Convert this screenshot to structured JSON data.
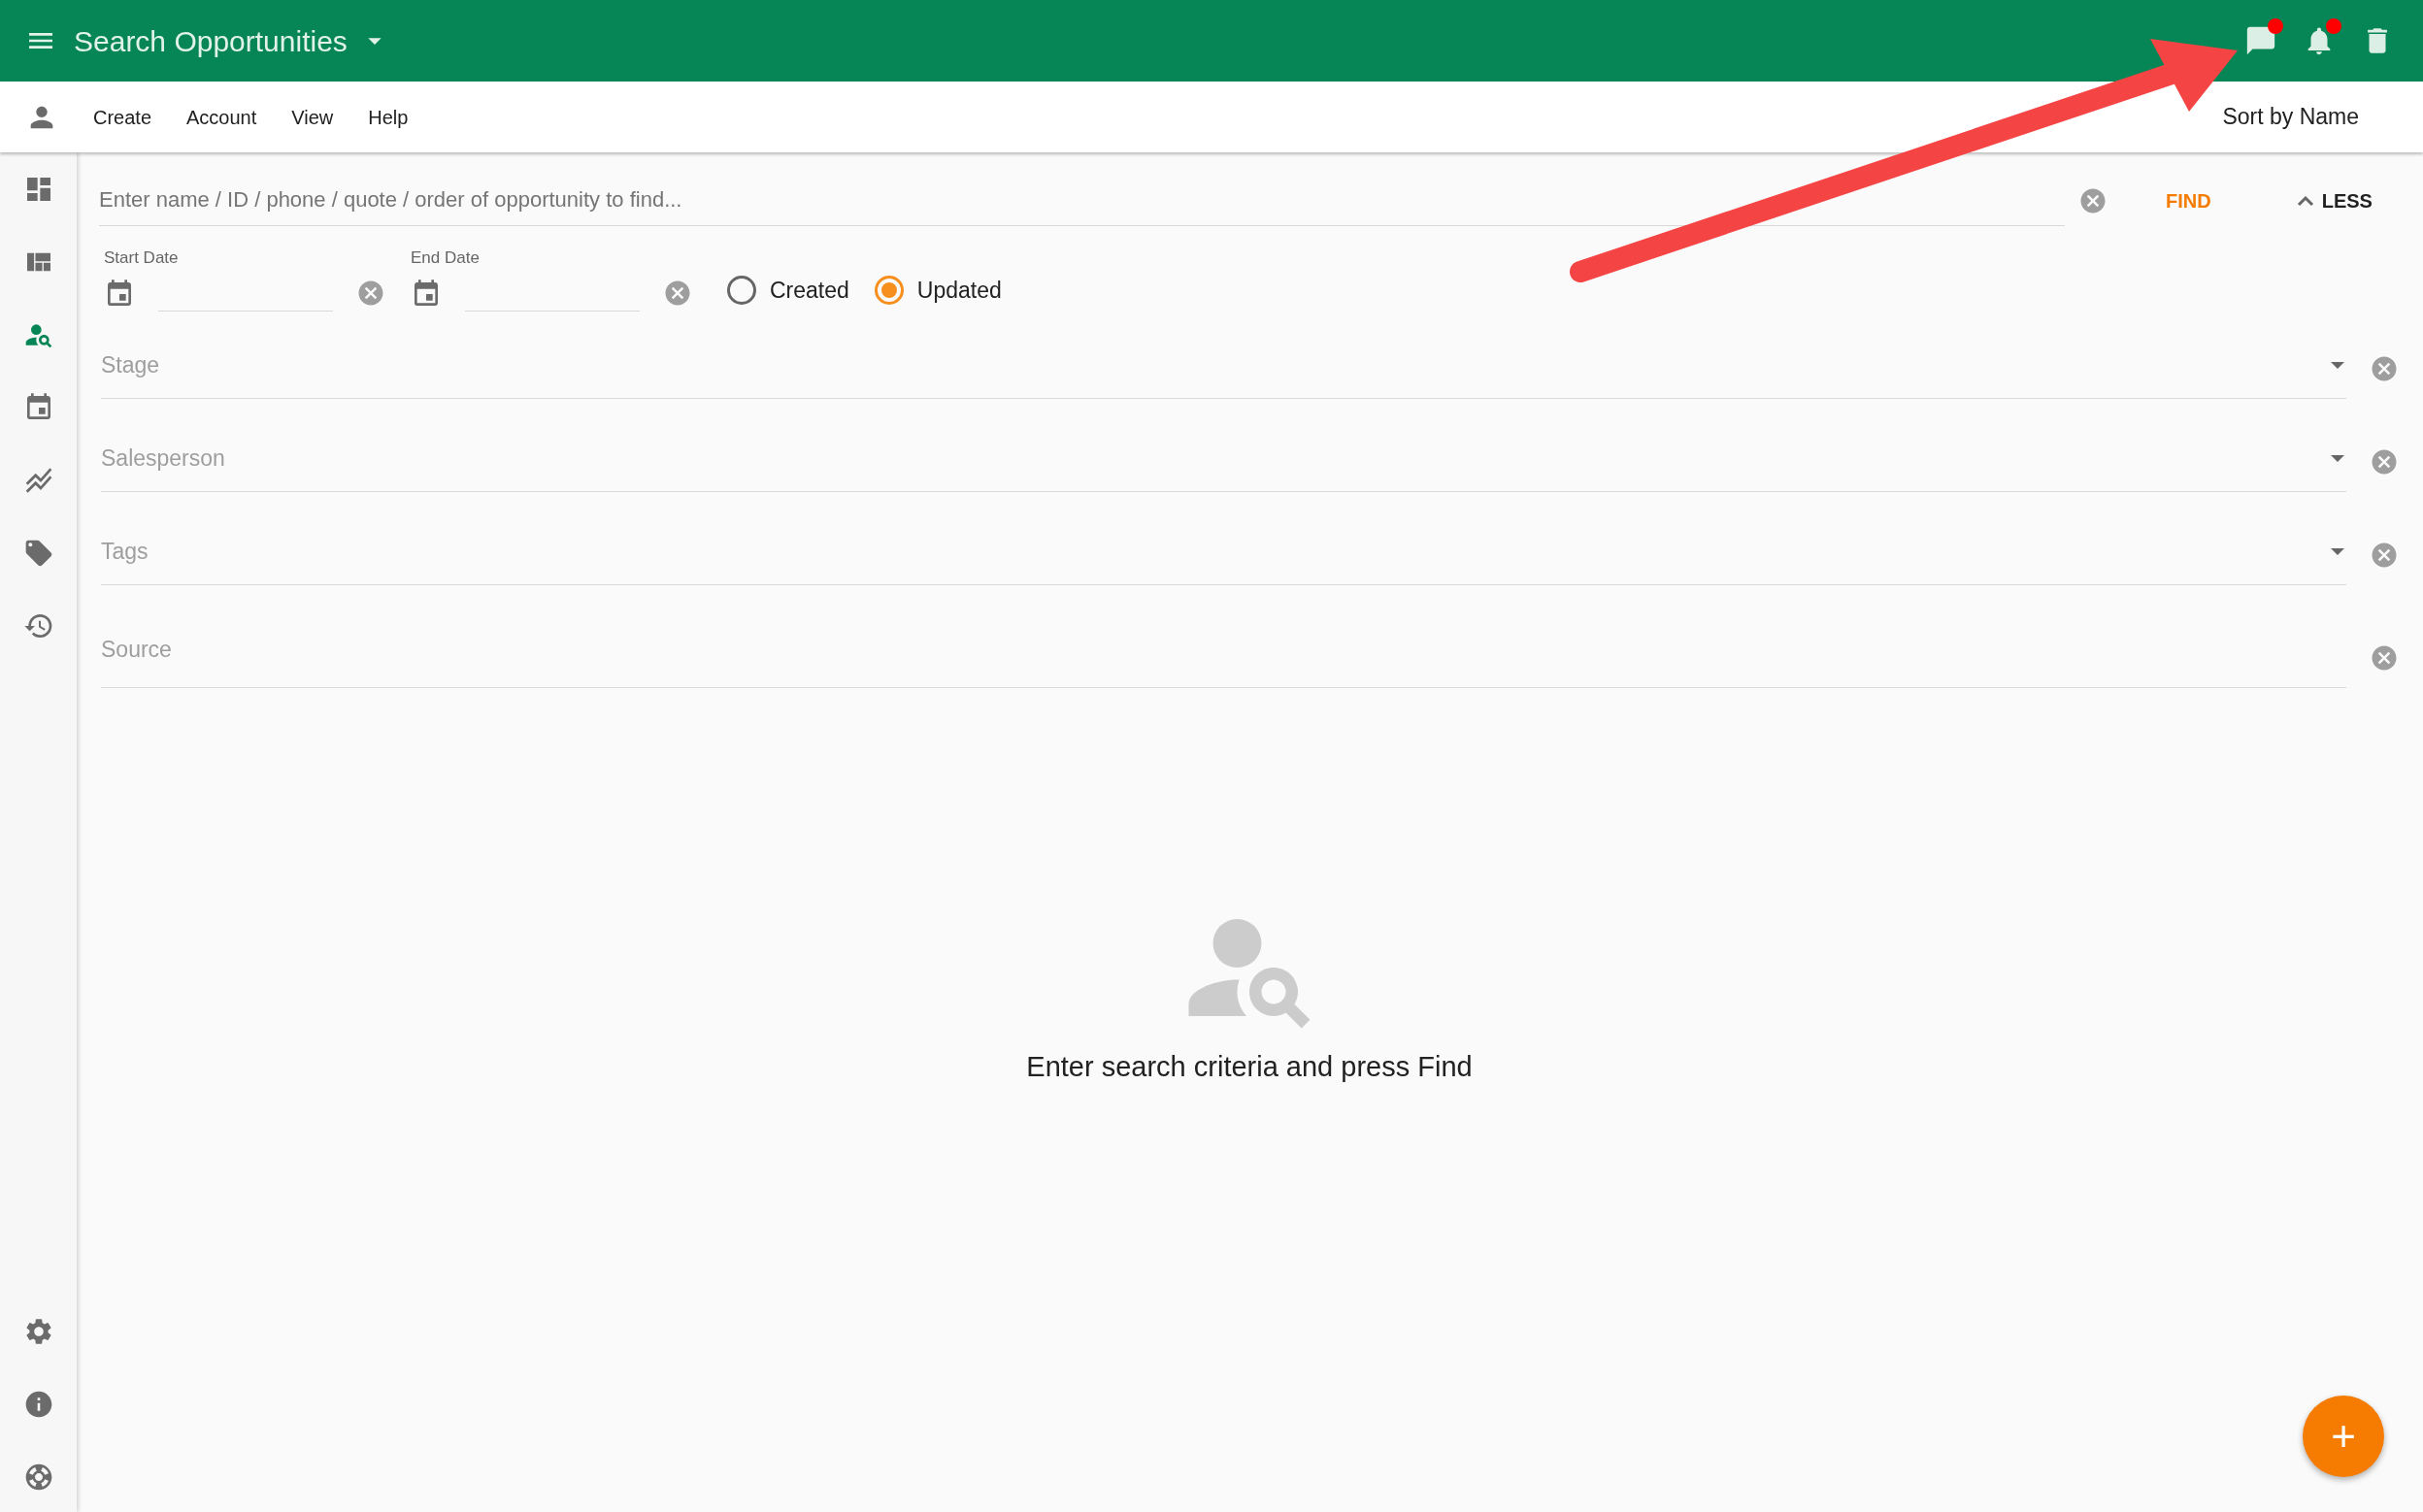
{
  "app_bar": {
    "title": "Search Opportunities",
    "actions": [
      {
        "kind": "chat",
        "unread": true
      },
      {
        "kind": "bell",
        "unread": true
      },
      {
        "kind": "trash",
        "unread": false
      }
    ]
  },
  "menu_bar": {
    "items": [
      "Create",
      "Account",
      "View",
      "Help"
    ],
    "sort": "Sort by Name"
  },
  "sidebar": {
    "items": [
      {
        "kind": "dashboard",
        "selected": false
      },
      {
        "kind": "board",
        "selected": false
      },
      {
        "kind": "person-search",
        "selected": true
      },
      {
        "kind": "calendar",
        "selected": false
      },
      {
        "kind": "chart",
        "selected": false
      },
      {
        "kind": "tag",
        "selected": false
      },
      {
        "kind": "history",
        "selected": false
      }
    ],
    "bottom": [
      {
        "kind": "settings"
      },
      {
        "kind": "info"
      },
      {
        "kind": "help"
      }
    ]
  },
  "search": {
    "placeholder": "Enter name / ID / phone / quote / order of opportunity to find...",
    "find": "FIND",
    "toggle": "LESS"
  },
  "dates": [
    {
      "label": "Start Date"
    },
    {
      "label": "End Date"
    }
  ],
  "date_type": [
    {
      "label": "Created",
      "selected": false
    },
    {
      "label": "Updated",
      "selected": true
    }
  ],
  "filters": [
    {
      "placeholder": "Stage",
      "dropdown": true
    },
    {
      "placeholder": "Salesperson",
      "dropdown": true
    },
    {
      "placeholder": "Tags",
      "dropdown": true
    },
    {
      "placeholder": "Source",
      "dropdown": false
    }
  ],
  "empty_state": {
    "message": "Enter search criteria and press Find"
  },
  "fab": {
    "label": "+"
  }
}
